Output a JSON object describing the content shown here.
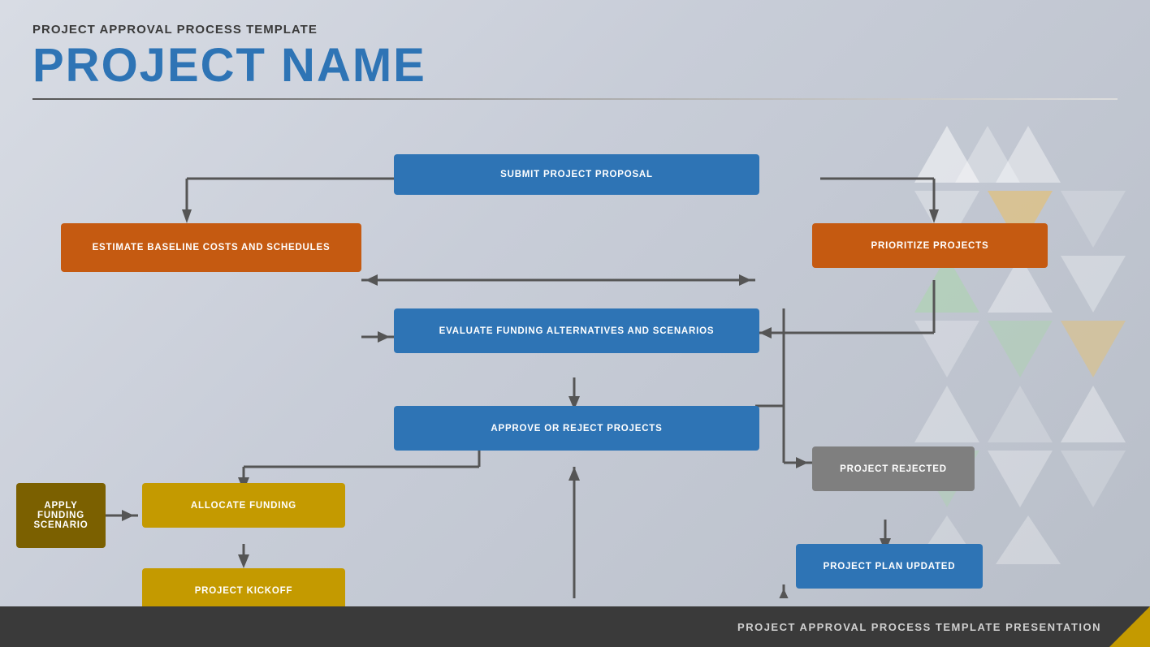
{
  "header": {
    "template_title": "PROJECT APPROVAL PROCESS TEMPLATE",
    "project_name": "PROJECT NAME"
  },
  "footer": {
    "text": "PROJECT APPROVAL PROCESS TEMPLATE PRESENTATION"
  },
  "boxes": {
    "submit_proposal": "SUBMIT PROJECT PROPOSAL",
    "estimate_baseline": "ESTIMATE BASELINE COSTS AND SCHEDULES",
    "prioritize_projects": "PRIORITIZE PROJECTS",
    "evaluate_funding": "EVALUATE FUNDING ALTERNATIVES AND SCENARIOS",
    "approve_reject": "APPROVE OR REJECT PROJECTS",
    "apply_funding": "APPLY FUNDING SCENARIO",
    "allocate_funding": "ALLOCATE FUNDING",
    "project_kickoff": "PROJECT KICKOFF",
    "project_rejected": "PROJECT REJECTED",
    "project_plan_updated": "PROJECT PLAN UPDATED"
  },
  "colors": {
    "blue": "#2e74b5",
    "orange": "#c55a11",
    "gold": "#c49a00",
    "dark_gold": "#7b6000",
    "gray": "#7f7f7f",
    "footer_bg": "#3a3a3a",
    "footer_accent": "#c49a00"
  }
}
